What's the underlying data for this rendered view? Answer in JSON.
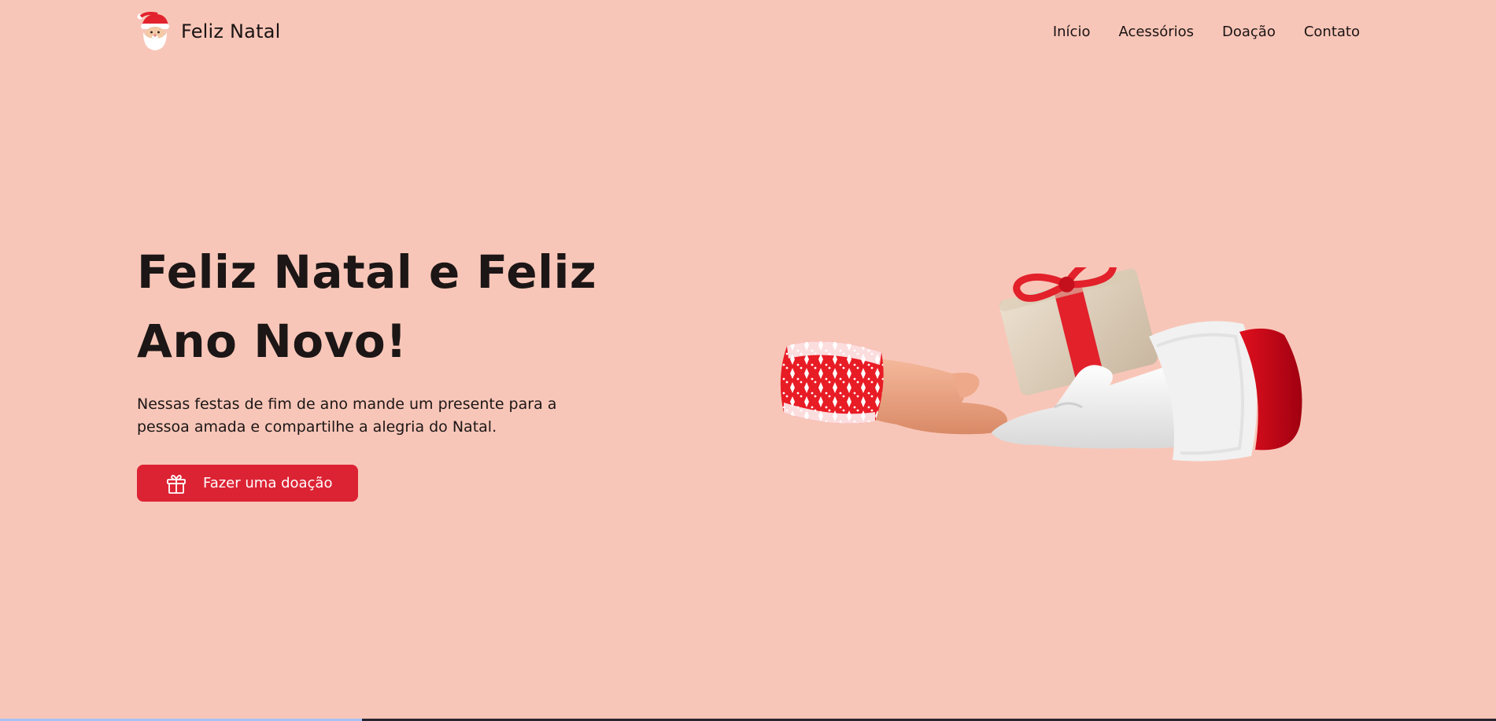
{
  "brand": {
    "name": "Feliz Natal",
    "logo_icon": "santa-face-icon"
  },
  "nav": {
    "items": [
      {
        "label": "Início"
      },
      {
        "label": "Acessórios"
      },
      {
        "label": "Doação"
      },
      {
        "label": "Contato"
      }
    ]
  },
  "hero": {
    "title_line1": "Feliz Natal e Feliz",
    "title_line2": "Ano Novo!",
    "description": "Nessas festas de fim de ano mande um presente para a pessoa amada e compartilhe a alegria do Natal.",
    "cta_label": "Fazer uma doação",
    "cta_icon": "gift-icon"
  },
  "illustration": {
    "icon": "hands-giving-gift-illustration"
  },
  "colors": {
    "background": "#f8c6b8",
    "accent": "#dc2334",
    "text": "#1c1616"
  }
}
